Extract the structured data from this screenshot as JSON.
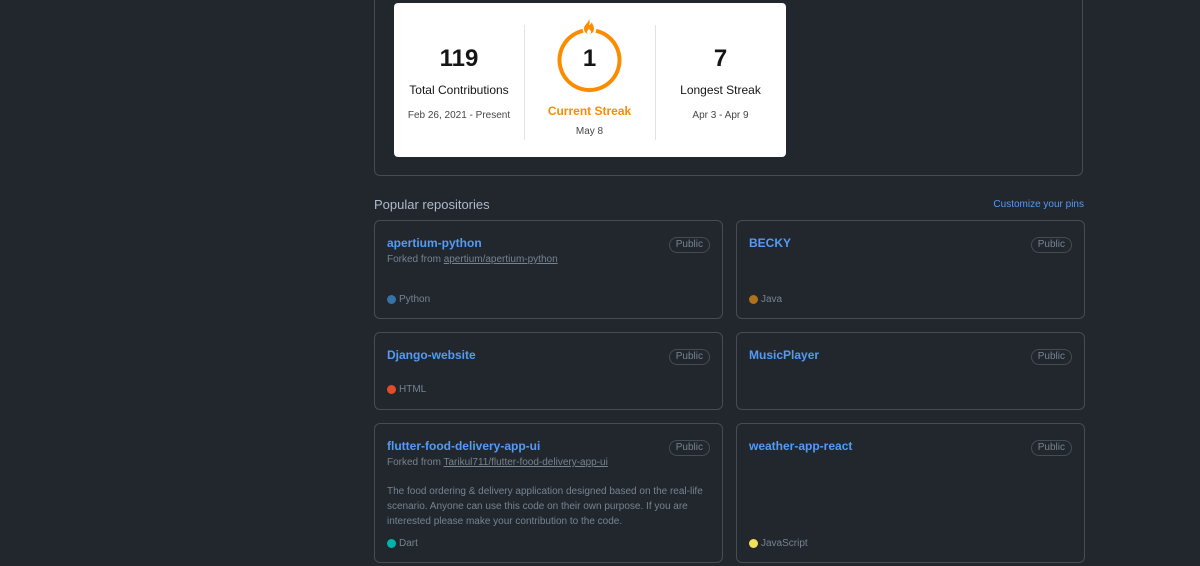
{
  "streak_stats": {
    "total_contributions": "119",
    "total_label": "Total Contributions",
    "total_range": "Feb 26, 2021 - Present",
    "current_streak": "1",
    "current_label": "Current Streak",
    "current_range": "May 8",
    "longest_streak": "7",
    "longest_label": "Longest Streak",
    "longest_range": "Apr 3 - Apr 9",
    "accent_color": "#fb8c00"
  },
  "popular": {
    "title": "Popular repositories",
    "customize_label": "Customize your pins",
    "repos": [
      {
        "name": "apertium-python",
        "visibility": "Public",
        "forked_prefix": "Forked from ",
        "forked_from": "apertium/apertium-python",
        "language": "Python",
        "language_color": "#3572A5"
      },
      {
        "name": "BECKY",
        "visibility": "Public",
        "language": "Java",
        "language_color": "#b07219"
      },
      {
        "name": "Django-website",
        "visibility": "Public",
        "language": "HTML",
        "language_color": "#e34c26"
      },
      {
        "name": "MusicPlayer",
        "visibility": "Public"
      },
      {
        "name": "flutter-food-delivery-app-ui",
        "visibility": "Public",
        "forked_prefix": "Forked from ",
        "forked_from": "Tarikul711/flutter-food-delivery-app-ui",
        "description": "The food ordering & delivery application designed based on the real-life scenario. Anyone can use this code on their own purpose. If you are interested please make your contribution to the code.",
        "language": "Dart",
        "language_color": "#00B4AB"
      },
      {
        "name": "weather-app-react",
        "visibility": "Public",
        "language": "JavaScript",
        "language_color": "#f1e05a"
      }
    ]
  }
}
